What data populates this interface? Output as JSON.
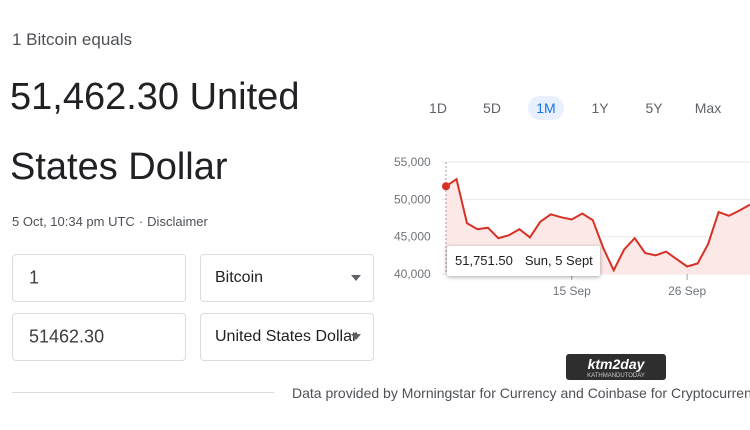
{
  "header": {
    "subtitle": "1 Bitcoin equals",
    "amount_line1": "51,462.30 United",
    "amount_line2": "States Dollar",
    "timestamp": "5 Oct, 10:34 pm UTC",
    "separator": "·",
    "disclaimer": "Disclaimer"
  },
  "converter": {
    "from_value": "1",
    "from_currency": "Bitcoin",
    "to_value": "51462.30",
    "to_currency": "United States Dollar"
  },
  "tabs": [
    {
      "label": "1D",
      "active": false
    },
    {
      "label": "5D",
      "active": false
    },
    {
      "label": "1M",
      "active": true
    },
    {
      "label": "1Y",
      "active": false
    },
    {
      "label": "5Y",
      "active": false
    },
    {
      "label": "Max",
      "active": false
    }
  ],
  "tooltip": {
    "value": "51,751.50",
    "date": "Sun, 5 Sept"
  },
  "credit": "Data provided by Morningstar for Currency and Coinbase for Cryptocurrency",
  "watermark": {
    "text": "ktm2day",
    "subtext": "KATHMANDUTODAY"
  },
  "colors": {
    "line": "#d93025",
    "area": "#fce8e6",
    "accent": "#1a73e8"
  },
  "chart_data": {
    "type": "area",
    "x_tick_labels": [
      "15 Sep",
      "26 Sep"
    ],
    "y_tick_labels": [
      "55,000",
      "50,000",
      "45,000",
      "40,000"
    ],
    "ylim": [
      40000,
      55000
    ],
    "values": [
      51751,
      52700,
      46800,
      46000,
      46200,
      44800,
      45200,
      46000,
      44900,
      47000,
      48000,
      47600,
      47300,
      48100,
      47200,
      43500,
      40500,
      43300,
      44800,
      42800,
      42500,
      43000,
      42000,
      41000,
      41400,
      44000,
      48300,
      47800,
      48500,
      49300
    ],
    "highlight_index": 0
  }
}
